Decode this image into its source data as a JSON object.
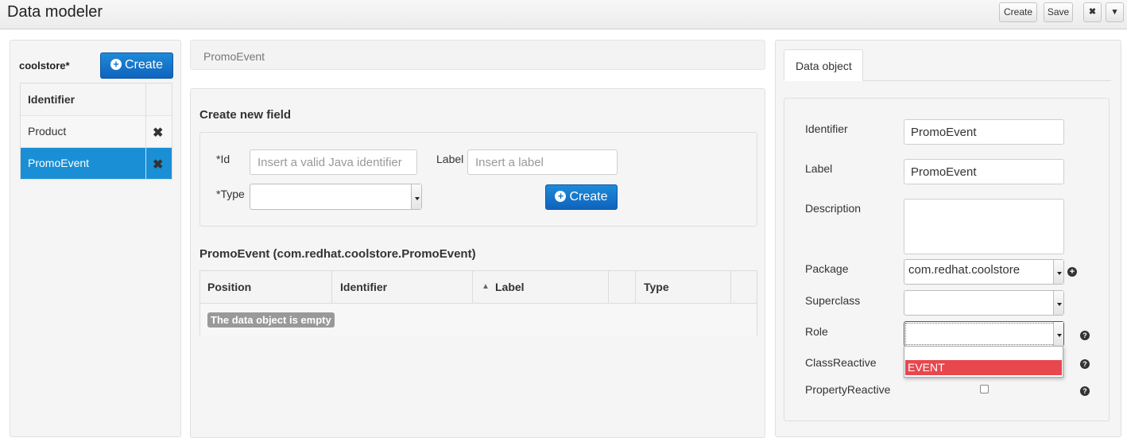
{
  "app": {
    "title": "Data modeler",
    "toolbar": {
      "create_label": "Create",
      "save_label": "Save",
      "close_glyph": "✖",
      "menu_glyph": "▾"
    }
  },
  "left": {
    "project_name": "coolstore*",
    "create_label": "Create",
    "table_header": "Identifier",
    "remove_glyph": "✖",
    "items": [
      {
        "label": "Product",
        "selected": false
      },
      {
        "label": "PromoEvent",
        "selected": true
      }
    ]
  },
  "middle": {
    "breadcrumb": "PromoEvent",
    "new_field": {
      "title": "Create new field",
      "id_label": "*Id",
      "id_placeholder": "Insert a valid Java identifier",
      "label_label": "Label",
      "label_placeholder": "Insert a label",
      "type_label": "*Type",
      "type_value": "",
      "create_label": "Create"
    },
    "fields_table": {
      "title": "PromoEvent (com.redhat.coolstore.PromoEvent)",
      "columns": [
        "Position",
        "Identifier",
        "Label",
        "Type"
      ],
      "sort_glyph": "▲",
      "empty_text": "The data object is empty"
    }
  },
  "right": {
    "tab_label": "Data object",
    "properties": {
      "identifier_label": "Identifier",
      "identifier_value": "PromoEvent",
      "label_label": "Label",
      "label_value": "PromoEvent",
      "description_label": "Description",
      "description_value": "",
      "package_label": "Package",
      "package_value": "com.redhat.coolstore",
      "superclass_label": "Superclass",
      "superclass_value": "",
      "role_label": "Role",
      "role_value": "",
      "role_options": [
        "",
        "EVENT"
      ],
      "role_highlighted": "EVENT",
      "classreactive_label": "ClassReactive",
      "propertyreactive_label": "PropertyReactive",
      "propertyreactive_checked": false,
      "help_glyph": "?",
      "add_glyph": "+"
    }
  },
  "colors": {
    "primary": "#1474c9",
    "selected_row": "#1b8fd5",
    "dropdown_highlight": "#e8474d"
  }
}
